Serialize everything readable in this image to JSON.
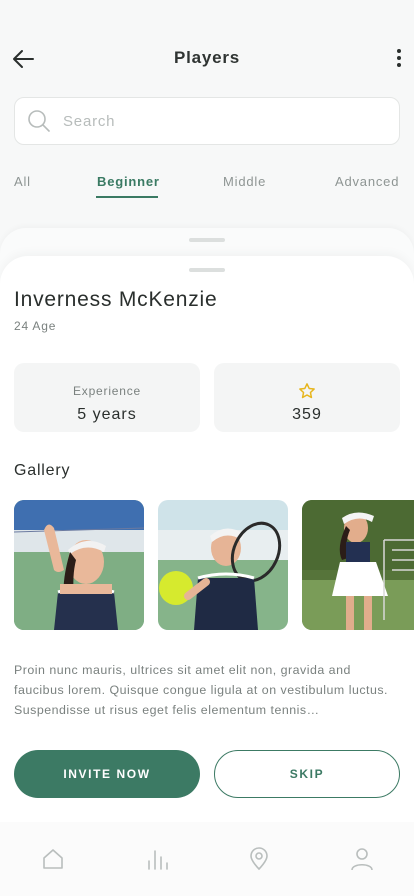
{
  "header": {
    "title": "Players"
  },
  "search": {
    "placeholder": "Search"
  },
  "tabs": [
    {
      "label": "All",
      "active": false
    },
    {
      "label": "Beginner",
      "active": true
    },
    {
      "label": "Middle",
      "active": false
    },
    {
      "label": "Advanced",
      "active": false
    }
  ],
  "player": {
    "name": "Inverness McKenzie",
    "age": "24 Age",
    "experience": {
      "label": "Experience",
      "value": "5 years"
    },
    "rating": {
      "icon": "star-icon",
      "value": "359"
    },
    "gallery_title": "Gallery",
    "description": "Proin nunc mauris, ultrices sit amet elit non, gravida and faucibus lorem. Quisque congue ligula at on vestibulum luctus. Suspendisse ut risus eget felis elementum tennis…"
  },
  "actions": {
    "invite_label": "INVITE NOW",
    "skip_label": "SKIP"
  },
  "bottom_nav": [
    {
      "icon": "home-icon"
    },
    {
      "icon": "stats-icon"
    },
    {
      "icon": "location-icon"
    },
    {
      "icon": "profile-icon"
    }
  ],
  "colors": {
    "accent": "#3c7a64",
    "star": "#e7b61f"
  }
}
